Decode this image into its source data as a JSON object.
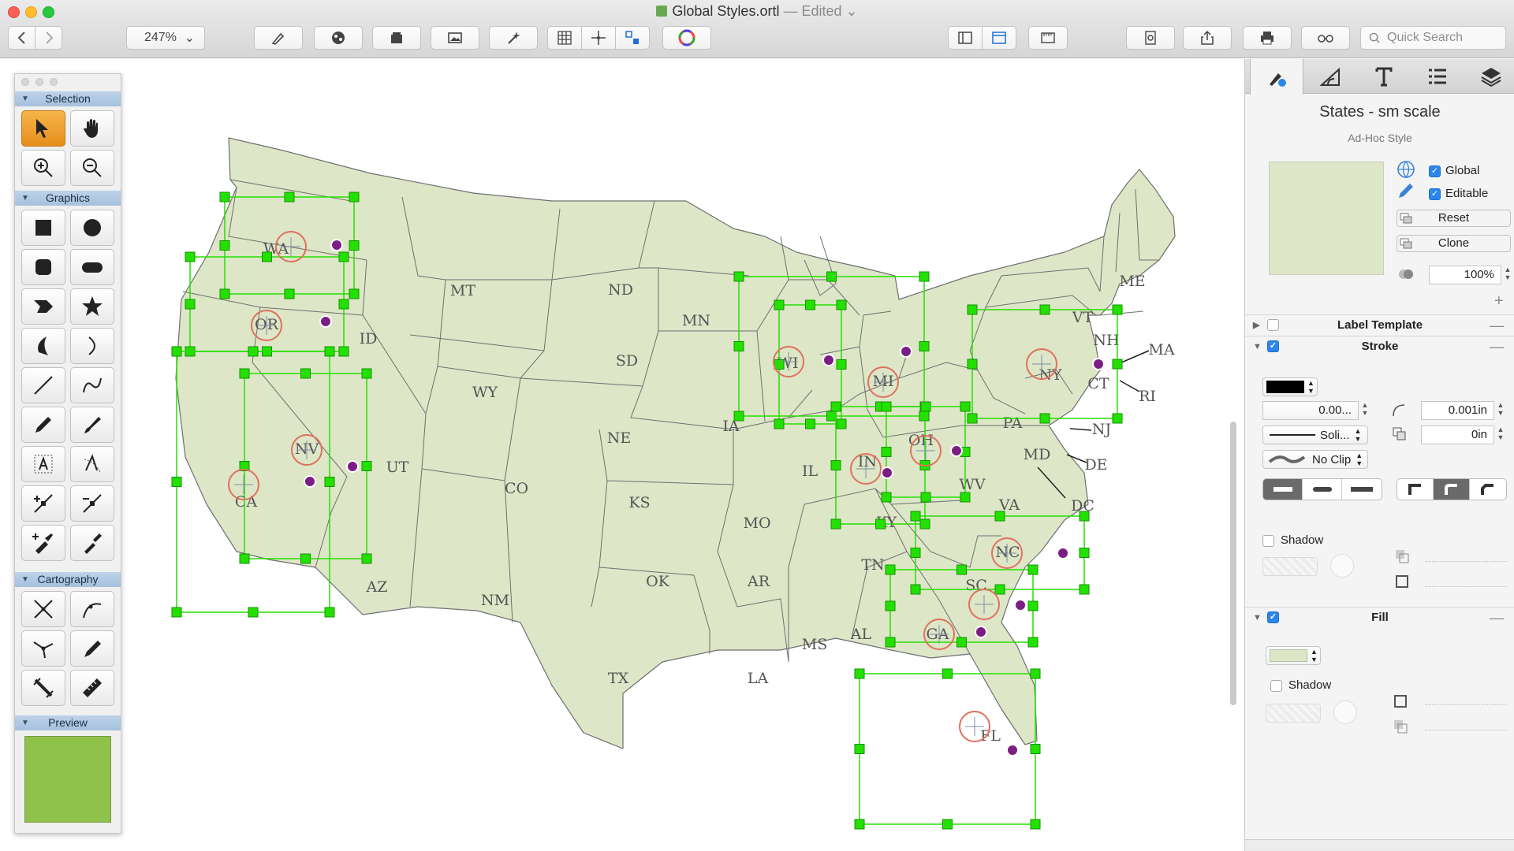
{
  "window": {
    "title": "Global Styles.ortl",
    "title_sep": " — ",
    "edited": "Edited ",
    "edited_caret": "⌄"
  },
  "toolbar": {
    "zoom": "247%",
    "zoom_caret": "⌄",
    "search_placeholder": "Quick Search"
  },
  "palette": {
    "sections": [
      "Selection",
      "Graphics",
      "Cartography",
      "Preview"
    ]
  },
  "inspector": {
    "style_name": "States - sm scale",
    "style_sub": "Ad-Hoc Style",
    "global_label": "Global",
    "editable_label": "Editable",
    "reset_label": "Reset",
    "clone_label": "Clone",
    "opacity": "100%",
    "add": "+",
    "sections": {
      "label_template": "Label Template",
      "stroke": "Stroke",
      "fill": "Fill"
    },
    "stroke": {
      "width": "0.00...",
      "pattern": "Soli...",
      "clip": "No Clip",
      "corner": "0.001in",
      "offset": "0in",
      "shadow_label": "Shadow"
    },
    "fill": {
      "shadow_label": "Shadow"
    }
  },
  "map": {
    "states": [
      "WA",
      "OR",
      "CA",
      "ID",
      "NV",
      "MT",
      "WY",
      "UT",
      "AZ",
      "CO",
      "NM",
      "ND",
      "SD",
      "NE",
      "KS",
      "OK",
      "TX",
      "MN",
      "IA",
      "MO",
      "AR",
      "LA",
      "WI",
      "IL",
      "MI",
      "IN",
      "OH",
      "KY",
      "TN",
      "MS",
      "AL",
      "GA",
      "FL",
      "SC",
      "NC",
      "VA",
      "WV",
      "PA",
      "NY",
      "VT",
      "NH",
      "ME",
      "MA",
      "CT",
      "RI",
      "NJ",
      "DE",
      "MD",
      "DC"
    ]
  },
  "colors": {
    "land": "#dde6c7",
    "border": "#6f6f6f",
    "selection": "#24e000",
    "target_ring": "#e07060",
    "handle_purple": "#7a1e84",
    "preview_fill": "#8fc24b"
  }
}
